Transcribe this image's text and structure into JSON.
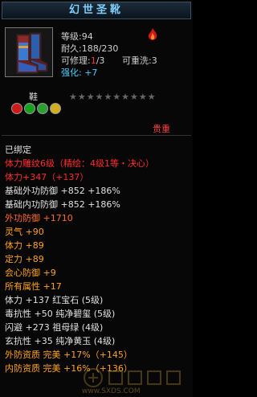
{
  "title": "幻世圣靴",
  "stats": {
    "level_line": "等级:94",
    "durability_line": "耐久:188/230",
    "repairable_prefix": "可修理:",
    "repairable_value": "1",
    "repairable_suffix": "/3",
    "rewash_line": "可重洗:3",
    "enhance_label": "强化:",
    "enhance_value": "+7"
  },
  "item_type": "鞋",
  "stars": "★★★★★★★★★★",
  "stars_filled": 0,
  "rarity": "贵重",
  "attributes": [
    {
      "text": "已绑定",
      "color": "#e0e0e0"
    },
    {
      "text": "体力雕纹6级（精绘：4级1等・决心）",
      "color": "#ff2b2b"
    },
    {
      "text": "体力+347（+137）",
      "color": "#ff2b2b"
    },
    {
      "text": "基础外功防御 +852 +186%",
      "color": "#e0e0e0"
    },
    {
      "text": "基础内功防御 +852 +186%",
      "color": "#e0e0e0"
    },
    {
      "text": "外功防御 +1710",
      "color": "#ff6a2b"
    },
    {
      "text": "灵气 +90",
      "color": "#ffa31a"
    },
    {
      "text": "体力 +89",
      "color": "#ffa31a"
    },
    {
      "text": "定力 +89",
      "color": "#ffa31a"
    },
    {
      "text": "会心防御 +9",
      "color": "#ffa31a"
    },
    {
      "text": "所有属性 +17",
      "color": "#ffa31a"
    },
    {
      "text": "体力 +137 红宝石 (5级)",
      "color": "#e0e0e0"
    },
    {
      "text": "毒抗性 +50 纯净碧玺 (5级)",
      "color": "#e0e0e0"
    },
    {
      "text": "闪避 +273 祖母绿 (4级)",
      "color": "#e0e0e0"
    },
    {
      "text": "玄抗性 +35 纯净黄玉 (4级)",
      "color": "#e0e0e0"
    },
    {
      "text": "外防资质 完美 +17%（+145）",
      "color": "#ffa31a"
    },
    {
      "text": "内防资质 完美 +16%（+136）",
      "color": "#ffa31a"
    }
  ],
  "watermark": "www.SXDS.COM",
  "colors": {
    "title": "#7fd0ff",
    "red": "#ff2b2b",
    "orange": "#ffa31a",
    "cyan": "#44d0ff"
  }
}
